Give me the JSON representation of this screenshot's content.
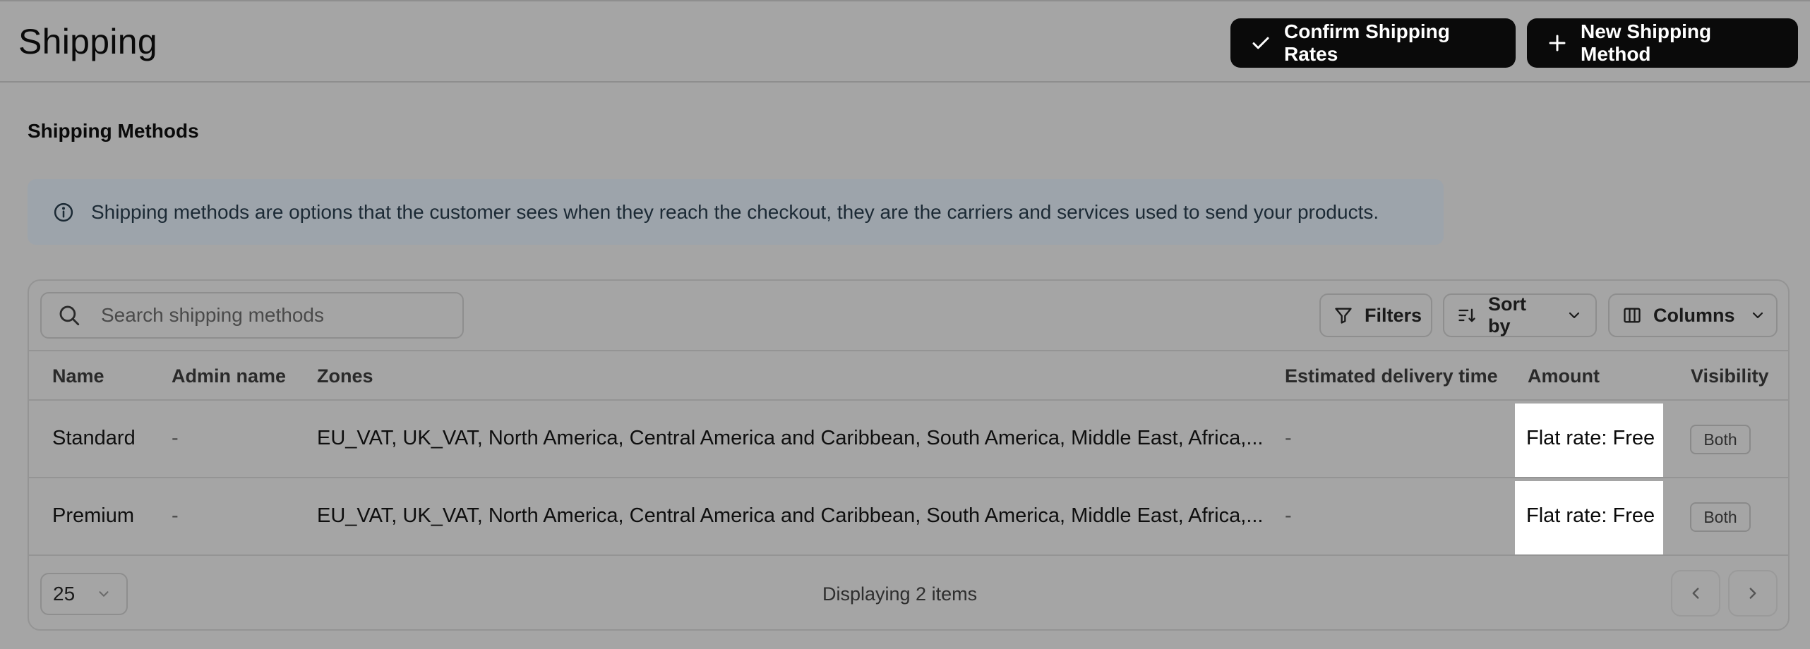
{
  "header": {
    "title": "Shipping",
    "confirm_label": "Confirm Shipping Rates",
    "new_label": "New Shipping Method"
  },
  "section": {
    "title": "Shipping Methods",
    "info": "Shipping methods are options that the customer sees when they reach the checkout, they are the carriers and services used to send your products."
  },
  "toolbar": {
    "search_placeholder": "Search shipping methods",
    "filters_label": "Filters",
    "sort_label": "Sort by",
    "columns_label": "Columns"
  },
  "table": {
    "columns": [
      "Name",
      "Admin name",
      "Zones",
      "Estimated delivery time",
      "Amount",
      "Visibility"
    ],
    "rows": [
      {
        "name": "Standard",
        "admin_name": "-",
        "zones": "EU_VAT, UK_VAT, North America, Central America and Caribbean, South America, Middle East, Africa,...",
        "delivery": "-",
        "amount": "Flat rate: Free",
        "visibility": "Both"
      },
      {
        "name": "Premium",
        "admin_name": "-",
        "zones": "EU_VAT, UK_VAT, North America, Central America and Caribbean, South America, Middle East, Africa,...",
        "delivery": "-",
        "amount": "Flat rate: Free",
        "visibility": "Both"
      }
    ]
  },
  "footer": {
    "page_size": "25",
    "status": "Displaying 2 items"
  },
  "icons": {
    "confirm": "check-icon",
    "new": "plus-icon",
    "info": "info-icon",
    "search": "search-icon",
    "filters": "filter-icon",
    "sort": "sort-icon",
    "columns": "columns-icon",
    "prev": "chevron-left-icon",
    "next": "chevron-right-icon"
  },
  "colors": {
    "button_bg": "#0a0a0a",
    "overlay_bg": "#a5a5a5",
    "info_bg": "#9da4ab",
    "highlight": "#ffffff"
  }
}
